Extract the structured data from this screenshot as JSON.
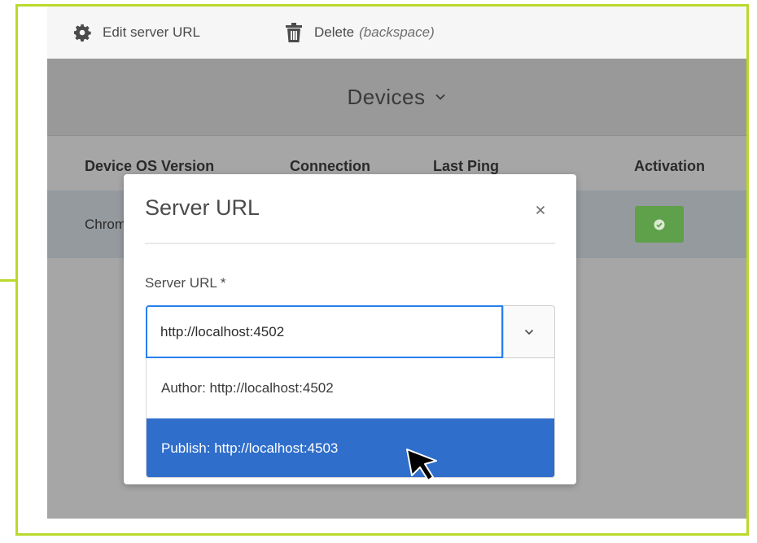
{
  "toolbar": {
    "edit_label": "Edit server URL",
    "edit_icon": "gear-icon",
    "delete_label": "Delete",
    "delete_hint": "(backspace)",
    "delete_icon": "trash-icon"
  },
  "header": {
    "title": "Devices",
    "title_icon": "chevron-down-icon"
  },
  "table": {
    "columns": [
      "Device OS Version",
      "Connection",
      "Last Ping",
      "Activation"
    ],
    "rows": [
      {
        "os": "Chrome",
        "activation_icon": "check-circle-icon"
      }
    ]
  },
  "modal": {
    "title": "Server URL",
    "close_icon": "close-icon",
    "field_label": "Server URL *",
    "input_value": "http://localhost:4502",
    "toggle_icon": "chevron-down-icon",
    "options": [
      "Author: http://localhost:4502",
      "Publish: http://localhost:4503"
    ],
    "highlighted_option": "Publish: http://localhost:4503"
  },
  "colors": {
    "accent_frame": "#b9d92b",
    "input_focus": "#2680eb",
    "highlight": "#2f6ecb",
    "activation_green": "#5fa04a"
  }
}
